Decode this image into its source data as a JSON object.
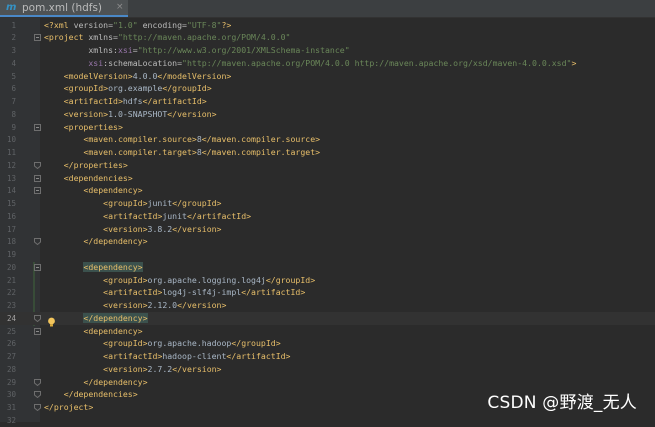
{
  "tab": {
    "label": "pom.xml (hdfs)",
    "icon": "maven-m-icon",
    "close": "×",
    "prefix": "m"
  },
  "watermark": "CSDN @野渡_无人",
  "current_line": 24,
  "lines": [
    {
      "n": "1",
      "segs": [
        [
          "tag",
          "<?xml "
        ],
        [
          "attr",
          "version="
        ],
        [
          "val",
          "\"1.0\""
        ],
        [
          "attr",
          " encoding="
        ],
        [
          "val",
          "\"UTF-8\""
        ],
        [
          "tag",
          "?>"
        ]
      ]
    },
    {
      "n": "2",
      "segs": [
        [
          "tag",
          "<project "
        ],
        [
          "attr",
          "xmlns="
        ],
        [
          "val",
          "\"http://maven.apache.org/POM/4.0.0\""
        ]
      ]
    },
    {
      "n": "3",
      "segs": [
        [
          "txt",
          "         "
        ],
        [
          "attr",
          "xmlns:"
        ],
        [
          "ns",
          "xsi"
        ],
        [
          "attr",
          "="
        ],
        [
          "val",
          "\"http://www.w3.org/2001/XMLSchema-instance\""
        ]
      ]
    },
    {
      "n": "4",
      "segs": [
        [
          "txt",
          "         "
        ],
        [
          "ns",
          "xsi"
        ],
        [
          "attr",
          ":schemaLocation="
        ],
        [
          "val",
          "\"http://maven.apache.org/POM/4.0.0 http://maven.apache.org/xsd/maven-4.0.0.xsd\""
        ],
        [
          "tag",
          ">"
        ]
      ]
    },
    {
      "n": "5",
      "segs": [
        [
          "txt",
          "    "
        ],
        [
          "tag",
          "<modelVersion>"
        ],
        [
          "txt",
          "4.0.0"
        ],
        [
          "tag",
          "</modelVersion>"
        ]
      ]
    },
    {
      "n": "6",
      "segs": [
        [
          "txt",
          "    "
        ],
        [
          "tag",
          "<groupId>"
        ],
        [
          "txt",
          "org.example"
        ],
        [
          "tag",
          "</groupId>"
        ]
      ]
    },
    {
      "n": "7",
      "segs": [
        [
          "txt",
          "    "
        ],
        [
          "tag",
          "<artifactId>"
        ],
        [
          "txt",
          "hdfs"
        ],
        [
          "tag",
          "</artifactId>"
        ]
      ]
    },
    {
      "n": "8",
      "segs": [
        [
          "txt",
          "    "
        ],
        [
          "tag",
          "<version>"
        ],
        [
          "txt",
          "1.0-SNAPSHOT"
        ],
        [
          "tag",
          "</version>"
        ]
      ]
    },
    {
      "n": "9",
      "segs": [
        [
          "txt",
          "    "
        ],
        [
          "tag",
          "<properties>"
        ]
      ]
    },
    {
      "n": "10",
      "segs": [
        [
          "txt",
          "        "
        ],
        [
          "tag",
          "<maven.compiler.source>"
        ],
        [
          "txt",
          "8"
        ],
        [
          "tag",
          "</maven.compiler.source>"
        ]
      ]
    },
    {
      "n": "11",
      "segs": [
        [
          "txt",
          "        "
        ],
        [
          "tag",
          "<maven.compiler.target>"
        ],
        [
          "txt",
          "8"
        ],
        [
          "tag",
          "</maven.compiler.target>"
        ]
      ]
    },
    {
      "n": "12",
      "segs": [
        [
          "txt",
          "    "
        ],
        [
          "tag",
          "</properties>"
        ]
      ]
    },
    {
      "n": "13",
      "segs": [
        [
          "txt",
          "    "
        ],
        [
          "tag",
          "<dependencies>"
        ]
      ]
    },
    {
      "n": "14",
      "segs": [
        [
          "txt",
          "        "
        ],
        [
          "tag",
          "<dependency>"
        ]
      ]
    },
    {
      "n": "15",
      "segs": [
        [
          "txt",
          "            "
        ],
        [
          "tag",
          "<groupId>"
        ],
        [
          "txt",
          "junit"
        ],
        [
          "tag",
          "</groupId>"
        ]
      ]
    },
    {
      "n": "16",
      "segs": [
        [
          "txt",
          "            "
        ],
        [
          "tag",
          "<artifactId>"
        ],
        [
          "txt",
          "junit"
        ],
        [
          "tag",
          "</artifactId>"
        ]
      ]
    },
    {
      "n": "17",
      "segs": [
        [
          "txt",
          "            "
        ],
        [
          "tag",
          "<version>"
        ],
        [
          "txt",
          "3.8.2"
        ],
        [
          "tag",
          "</version>"
        ]
      ]
    },
    {
      "n": "18",
      "segs": [
        [
          "txt",
          "        "
        ],
        [
          "tag",
          "</dependency>"
        ]
      ]
    },
    {
      "n": "19",
      "segs": []
    },
    {
      "n": "20",
      "segs": [
        [
          "txt",
          "        "
        ],
        [
          "tag hl",
          "<dependency>"
        ]
      ]
    },
    {
      "n": "21",
      "segs": [
        [
          "txt",
          "            "
        ],
        [
          "tag",
          "<groupId>"
        ],
        [
          "txt",
          "org.apache.logging.log4j"
        ],
        [
          "tag",
          "</groupId>"
        ]
      ]
    },
    {
      "n": "22",
      "segs": [
        [
          "txt",
          "            "
        ],
        [
          "tag",
          "<artifactId>"
        ],
        [
          "txt",
          "log4j-slf4j-impl"
        ],
        [
          "tag",
          "</artifactId>"
        ]
      ]
    },
    {
      "n": "23",
      "segs": [
        [
          "txt",
          "            "
        ],
        [
          "tag",
          "<version>"
        ],
        [
          "txt",
          "2.12.0"
        ],
        [
          "tag",
          "</version>"
        ]
      ]
    },
    {
      "n": "24",
      "segs": [
        [
          "txt",
          "        "
        ],
        [
          "tag hl",
          "</dependency>"
        ]
      ]
    },
    {
      "n": "25",
      "segs": [
        [
          "txt",
          "        "
        ],
        [
          "tag",
          "<dependency>"
        ]
      ]
    },
    {
      "n": "26",
      "segs": [
        [
          "txt",
          "            "
        ],
        [
          "tag",
          "<groupId>"
        ],
        [
          "txt",
          "org.apache.hadoop"
        ],
        [
          "tag",
          "</groupId>"
        ]
      ]
    },
    {
      "n": "27",
      "segs": [
        [
          "txt",
          "            "
        ],
        [
          "tag",
          "<artifactId>"
        ],
        [
          "txt",
          "hadoop-client"
        ],
        [
          "tag",
          "</artifactId>"
        ]
      ]
    },
    {
      "n": "28",
      "segs": [
        [
          "txt",
          "            "
        ],
        [
          "tag",
          "<version>"
        ],
        [
          "txt",
          "2.7.2"
        ],
        [
          "tag",
          "</version>"
        ]
      ]
    },
    {
      "n": "29",
      "segs": [
        [
          "txt",
          "        "
        ],
        [
          "tag",
          "</dependency>"
        ]
      ]
    },
    {
      "n": "30",
      "segs": [
        [
          "txt",
          "    "
        ],
        [
          "tag",
          "</dependencies>"
        ]
      ]
    },
    {
      "n": "31",
      "segs": [
        [
          "tag",
          "</project>"
        ]
      ]
    },
    {
      "n": "32",
      "segs": []
    }
  ],
  "fold_markers": [
    {
      "line": 2,
      "kind": "open"
    },
    {
      "line": 9,
      "kind": "open"
    },
    {
      "line": 12,
      "kind": "close"
    },
    {
      "line": 13,
      "kind": "open"
    },
    {
      "line": 14,
      "kind": "open"
    },
    {
      "line": 18,
      "kind": "close"
    },
    {
      "line": 20,
      "kind": "open"
    },
    {
      "line": 24,
      "kind": "close"
    },
    {
      "line": 25,
      "kind": "open"
    },
    {
      "line": 29,
      "kind": "close"
    },
    {
      "line": 30,
      "kind": "close"
    },
    {
      "line": 31,
      "kind": "close"
    }
  ],
  "intention_bulb": {
    "line": 24,
    "icon": "lightbulb-icon"
  },
  "colors": {
    "tag": "#e8bf6a",
    "attr": "#bababa",
    "ns": "#9876aa",
    "value": "#6a8759",
    "text": "#a9b7c6",
    "background": "#2b2b2b"
  }
}
